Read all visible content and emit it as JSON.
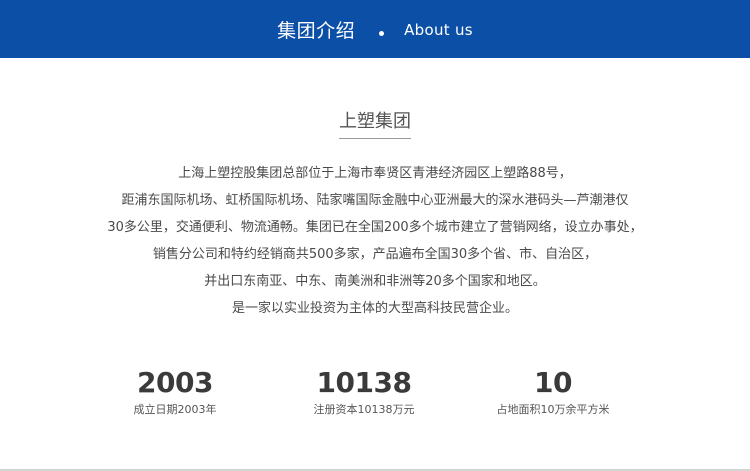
{
  "header": {
    "title_cn": "集团介绍",
    "title_en": "About us"
  },
  "section": {
    "title": "上塑集团"
  },
  "intro": {
    "lines": [
      "上海上塑控股集团总部位于上海市奉贤区青港经济园区上塑路88号，",
      "距浦东国际机场、虹桥国际机场、陆家嘴国际金融中心亚洲最大的深水港码头—芦潮港仅",
      "30多公里，交通便利、物流通畅。集团已在全国200多个城市建立了营销网络，设立办事处，",
      "销售分公司和特约经销商共500多家，产品遍布全国30多个省、市、自治区，",
      "并出口东南亚、中东、南美洲和非洲等20多个国家和地区。",
      "是一家以实业投资为主体的大型高科技民营企业。"
    ]
  },
  "stats": [
    {
      "value": "2003",
      "label": "成立日期2003年"
    },
    {
      "value": "10138",
      "label": "注册资本10138万元"
    },
    {
      "value": "10",
      "label": "占地面积10万余平方米"
    }
  ],
  "colors": {
    "header_bg": "#0b4fa6",
    "header_text": "#ffffff"
  }
}
